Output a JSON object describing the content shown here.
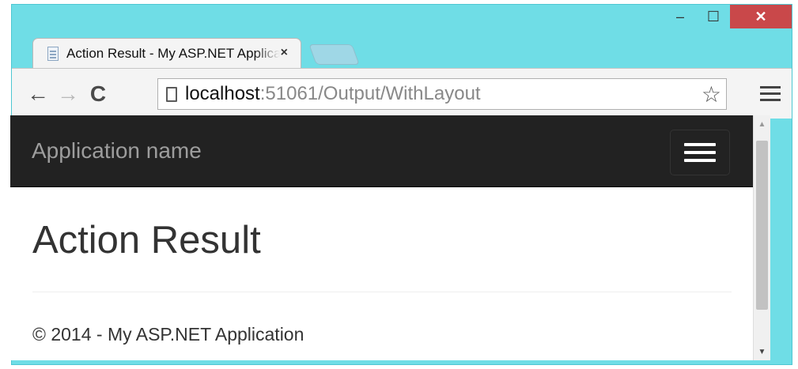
{
  "browser": {
    "tab_title": "Action Result - My ASP.NET Application",
    "tab_close": "×",
    "url_host": "localhost",
    "url_path": ":51061/Output/WithLayout",
    "window_controls": {
      "minimize": "–",
      "maximize": "☐",
      "close": "✕"
    },
    "nav": {
      "back": "←",
      "forward": "→",
      "reload": "C"
    },
    "star": "☆"
  },
  "site": {
    "brand": "Application name",
    "heading": "Action Result",
    "footer": "© 2014 - My ASP.NET Application"
  },
  "colors": {
    "window_frame": "#6fdde6",
    "navbar": "#222222",
    "brand_text": "#9d9d9d",
    "close_button": "#c9484a"
  },
  "icons": [
    "page-icon",
    "star-icon",
    "menu-icon",
    "hamburger-icon",
    "back-icon",
    "forward-icon",
    "reload-icon"
  ]
}
